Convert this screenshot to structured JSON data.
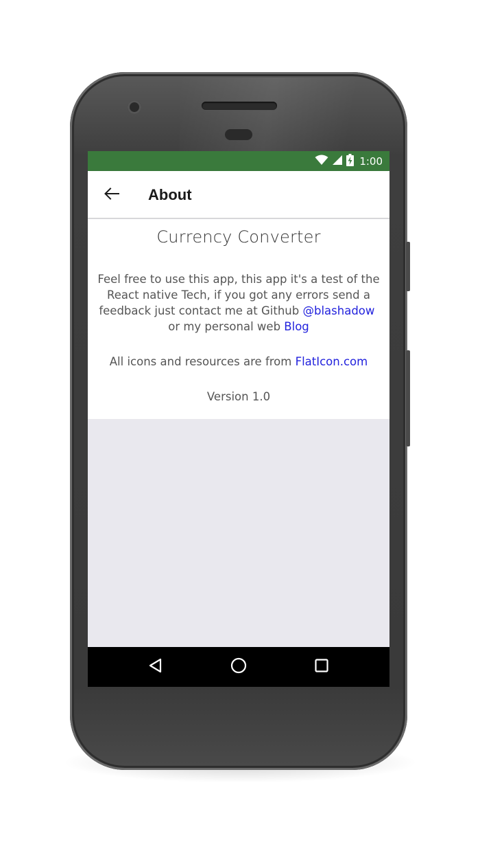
{
  "status_bar": {
    "time": "1:00",
    "icons": [
      "wifi-icon",
      "signal-icon",
      "battery-charging-icon"
    ],
    "color": "#3a7a3c"
  },
  "app_bar": {
    "title": "About",
    "back_icon": "arrow-left-icon"
  },
  "about": {
    "heading": "Currency Converter",
    "description_text": "Feel free to use this app, this app it's a test of the React native Tech, if you got any errors send a feedback just contact me at Github",
    "github_link": "@blashadow",
    "blog_prefix": "or my personal web",
    "blog_link": "Blog",
    "credits_text": "All icons and resources are from",
    "credits_link": "FlatIcon.com",
    "version": "Version 1.0",
    "link_color": "#2222dd"
  },
  "nav_bar": {
    "buttons": [
      "back-triangle-icon",
      "home-circle-icon",
      "recents-square-icon"
    ]
  }
}
